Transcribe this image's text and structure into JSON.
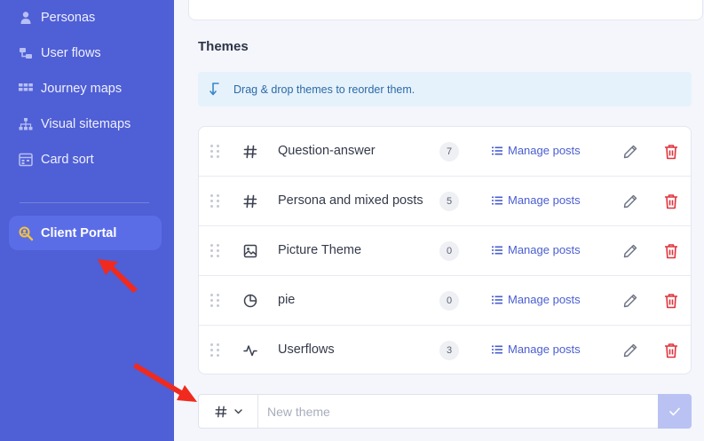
{
  "sidebar": {
    "items": [
      {
        "label": "Personas",
        "icon": "person-icon"
      },
      {
        "label": "User flows",
        "icon": "user-flows-icon"
      },
      {
        "label": "Journey maps",
        "icon": "grid-icon"
      },
      {
        "label": "Visual sitemaps",
        "icon": "sitemap-icon"
      },
      {
        "label": "Card sort",
        "icon": "card-sort-icon"
      }
    ],
    "active": {
      "label": "Client Portal",
      "icon": "client-portal-icon"
    }
  },
  "themes": {
    "title": "Themes",
    "info": "Drag & drop themes to reorder them.",
    "manage_label": "Manage posts",
    "rows": [
      {
        "name": "Question-answer",
        "count": "7",
        "icon": "hash-icon"
      },
      {
        "name": "Persona and mixed posts",
        "count": "5",
        "icon": "hash-icon"
      },
      {
        "name": "Picture Theme",
        "count": "0",
        "icon": "image-icon"
      },
      {
        "name": "pie",
        "count": "0",
        "icon": "pie-chart-icon"
      },
      {
        "name": "Userflows",
        "count": "3",
        "icon": "activity-icon"
      }
    ]
  },
  "new_theme": {
    "placeholder": "New theme",
    "type_icon": "hash-icon"
  },
  "colors": {
    "sidebar": "#4f5fd5",
    "accent": "#4a5ed0",
    "delete": "#e0323c",
    "annotation": "#f02a1e"
  }
}
